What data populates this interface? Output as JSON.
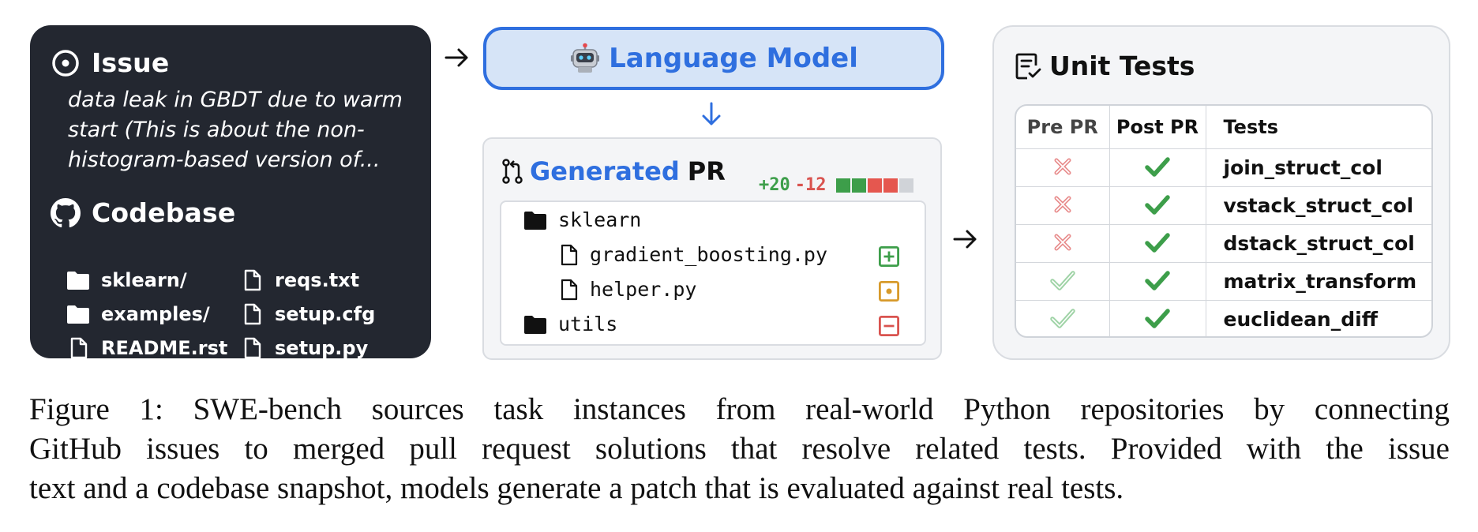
{
  "issue": {
    "title": "Issue",
    "lines": [
      "data leak in GBDT due to warm",
      "start (This is about the non-",
      "histogram-based version of..."
    ]
  },
  "codebase": {
    "title": "Codebase",
    "items": [
      {
        "name": "sklearn/",
        "icon": "folder-icon"
      },
      {
        "name": "examples/",
        "icon": "folder-icon"
      },
      {
        "name": "README.rst",
        "icon": "file-icon"
      },
      {
        "name": "reqs.txt",
        "icon": "file-icon"
      },
      {
        "name": "setup.cfg",
        "icon": "file-icon"
      },
      {
        "name": "setup.py",
        "icon": "file-icon"
      }
    ]
  },
  "language_model": {
    "label": "Language Model",
    "icon": "robot-icon"
  },
  "generated_pr": {
    "title_highlight": "Generated",
    "title_rest": "PR",
    "additions": "+20",
    "deletions": "-12",
    "diffstat_blocks": [
      "added",
      "added",
      "removed",
      "removed",
      "neutral"
    ],
    "files": [
      {
        "name": "sklearn",
        "type": "folder",
        "status": ""
      },
      {
        "name": "gradient_boosting.py",
        "type": "file",
        "status": "added"
      },
      {
        "name": "helper.py",
        "type": "file",
        "status": "modified"
      },
      {
        "name": "utils",
        "type": "folder",
        "status": "removed"
      }
    ]
  },
  "unit_tests": {
    "title": "Unit Tests",
    "columns": [
      "Pre PR",
      "Post PR",
      "Tests"
    ],
    "rows": [
      {
        "pre": "fail",
        "post": "pass",
        "test": "join_struct_col"
      },
      {
        "pre": "fail",
        "post": "pass",
        "test": "vstack_struct_col"
      },
      {
        "pre": "fail",
        "post": "pass",
        "test": "dstack_struct_col"
      },
      {
        "pre": "pass",
        "post": "pass",
        "test": "matrix_transform"
      },
      {
        "pre": "pass",
        "post": "pass",
        "test": "euclidean_diff"
      }
    ]
  },
  "colors": {
    "dark_panel": "#232730",
    "accent_blue": "#2f6fdf",
    "lm_fill": "#d6e4f7",
    "pass_green": "#3d9e4a",
    "fail_red": "#d9534f",
    "modified_orange": "#d79a2b"
  },
  "caption": {
    "lines": [
      "Figure 1: SWE-bench sources task instances from real-world Python repositories by connecting",
      "GitHub issues to merged pull request solutions that resolve related tests. Provided with the issue",
      "text and a codebase snapshot, models generate a patch that is evaluated against real tests."
    ]
  }
}
